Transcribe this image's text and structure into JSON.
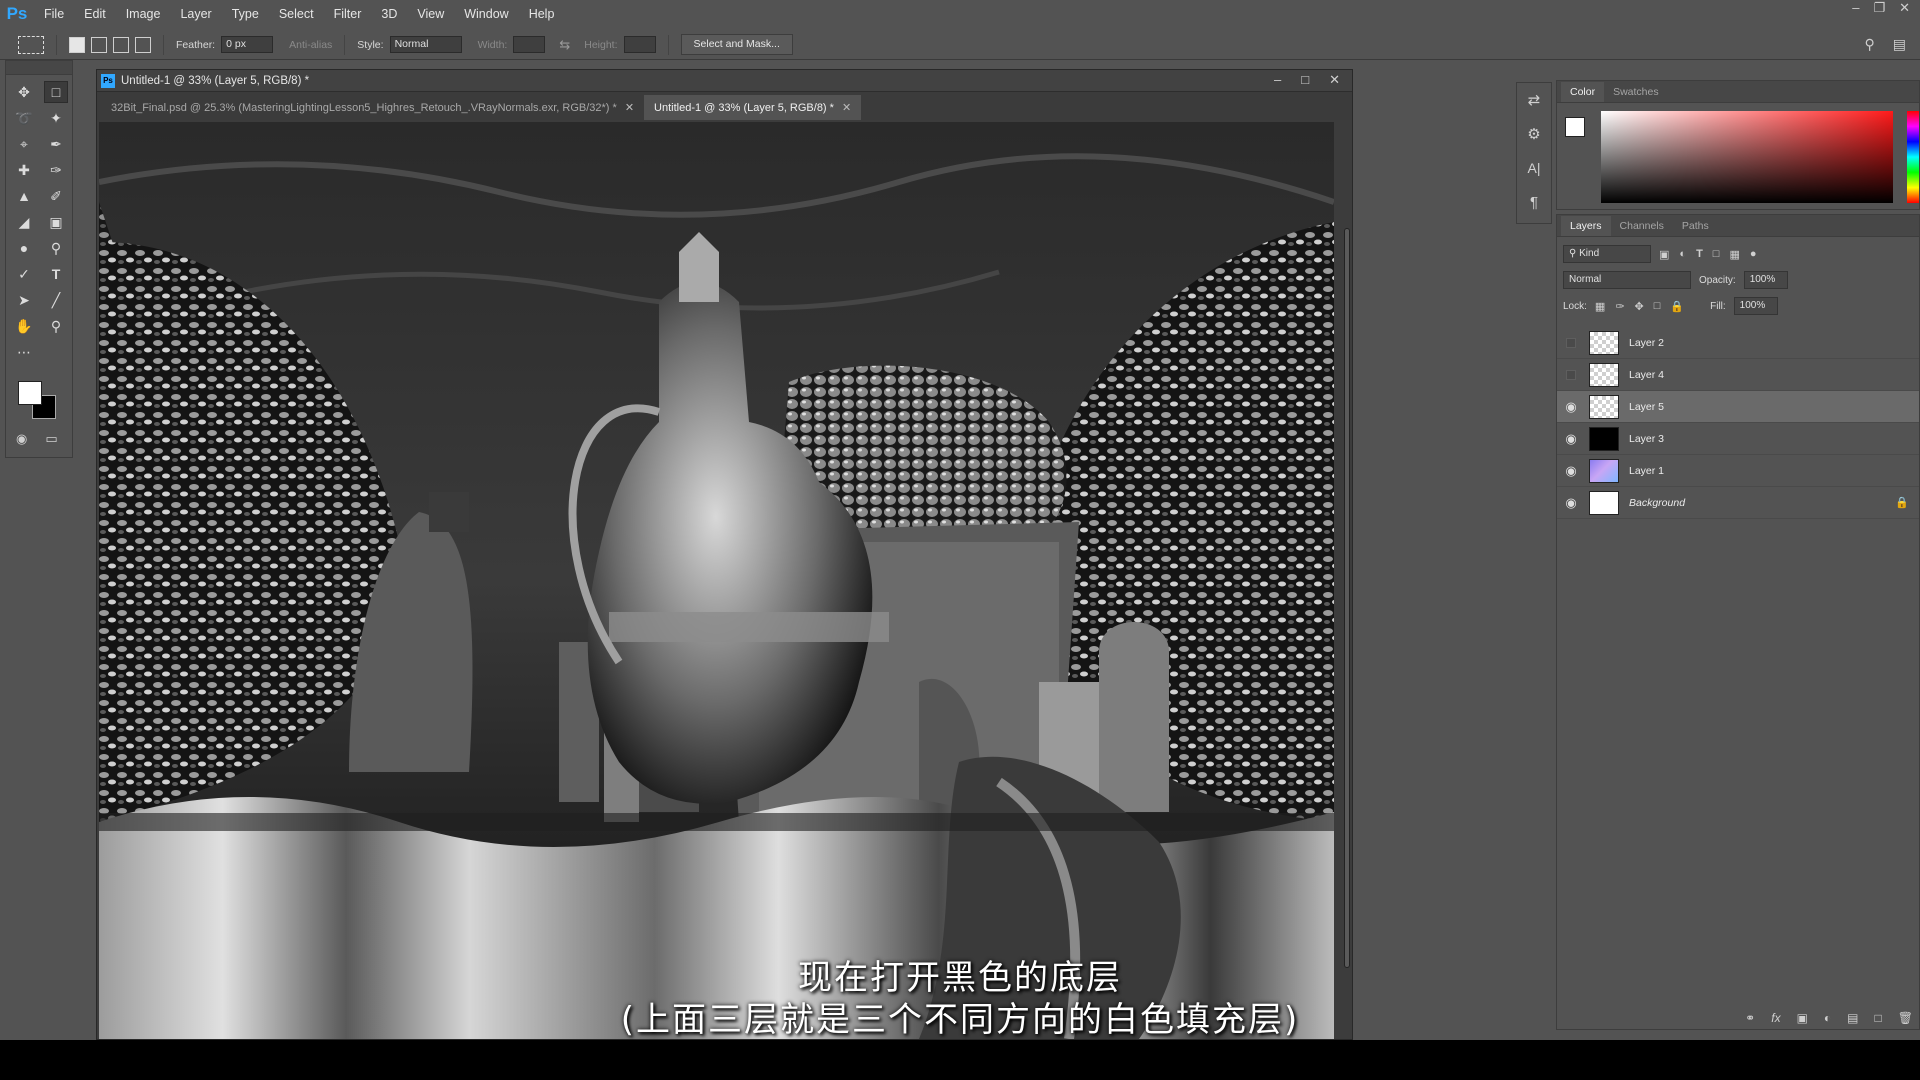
{
  "app": {
    "logo": "Ps",
    "menu": [
      "File",
      "Edit",
      "Image",
      "Layer",
      "Type",
      "Select",
      "Filter",
      "3D",
      "View",
      "Window",
      "Help"
    ]
  },
  "options": {
    "feather_label": "Feather:",
    "feather_value": "0 px",
    "antialias_label": "Anti-alias",
    "style_label": "Style:",
    "style_value": "Normal",
    "width_label": "Width:",
    "height_label": "Height:",
    "select_mask_label": "Select and Mask..."
  },
  "document": {
    "window_title": "Untitled-1 @ 33% (Layer 5, RGB/8) *",
    "tabs": [
      {
        "label": "32Bit_Final.psd @ 25.3% (MasteringLightingLesson5_Highres_Retouch_.VRayNormals.exr, RGB/32*) *",
        "active": false
      },
      {
        "label": "Untitled-1 @ 33% (Layer 5, RGB/8) *",
        "active": true
      }
    ]
  },
  "color_panel": {
    "tabs": [
      "Color",
      "Swatches"
    ],
    "foreground": "#ffffff",
    "background": "#000000",
    "hue": "#ff1a1a"
  },
  "layers_panel": {
    "tabs": [
      "Layers",
      "Channels",
      "Paths"
    ],
    "filter_kind": "Kind",
    "blend_mode": "Normal",
    "opacity_label": "Opacity:",
    "opacity_value": "100%",
    "lock_label": "Lock:",
    "fill_label": "Fill:",
    "fill_value": "100%",
    "layers": [
      {
        "name": "Layer 2",
        "visible": false,
        "thumb": "checker",
        "selected": false
      },
      {
        "name": "Layer 4",
        "visible": false,
        "thumb": "checker",
        "selected": false
      },
      {
        "name": "Layer 5",
        "visible": true,
        "thumb": "checker",
        "selected": true
      },
      {
        "name": "Layer 3",
        "visible": true,
        "thumb": "black",
        "selected": false
      },
      {
        "name": "Layer 1",
        "visible": true,
        "thumb": "normals",
        "selected": false
      },
      {
        "name": "Background",
        "visible": true,
        "thumb": "white",
        "selected": false,
        "locked": true
      }
    ]
  },
  "subtitles": {
    "line1": "现在打开黑色的底层",
    "line2": "(上面三层就是三个不同方向的白色填充层)"
  }
}
